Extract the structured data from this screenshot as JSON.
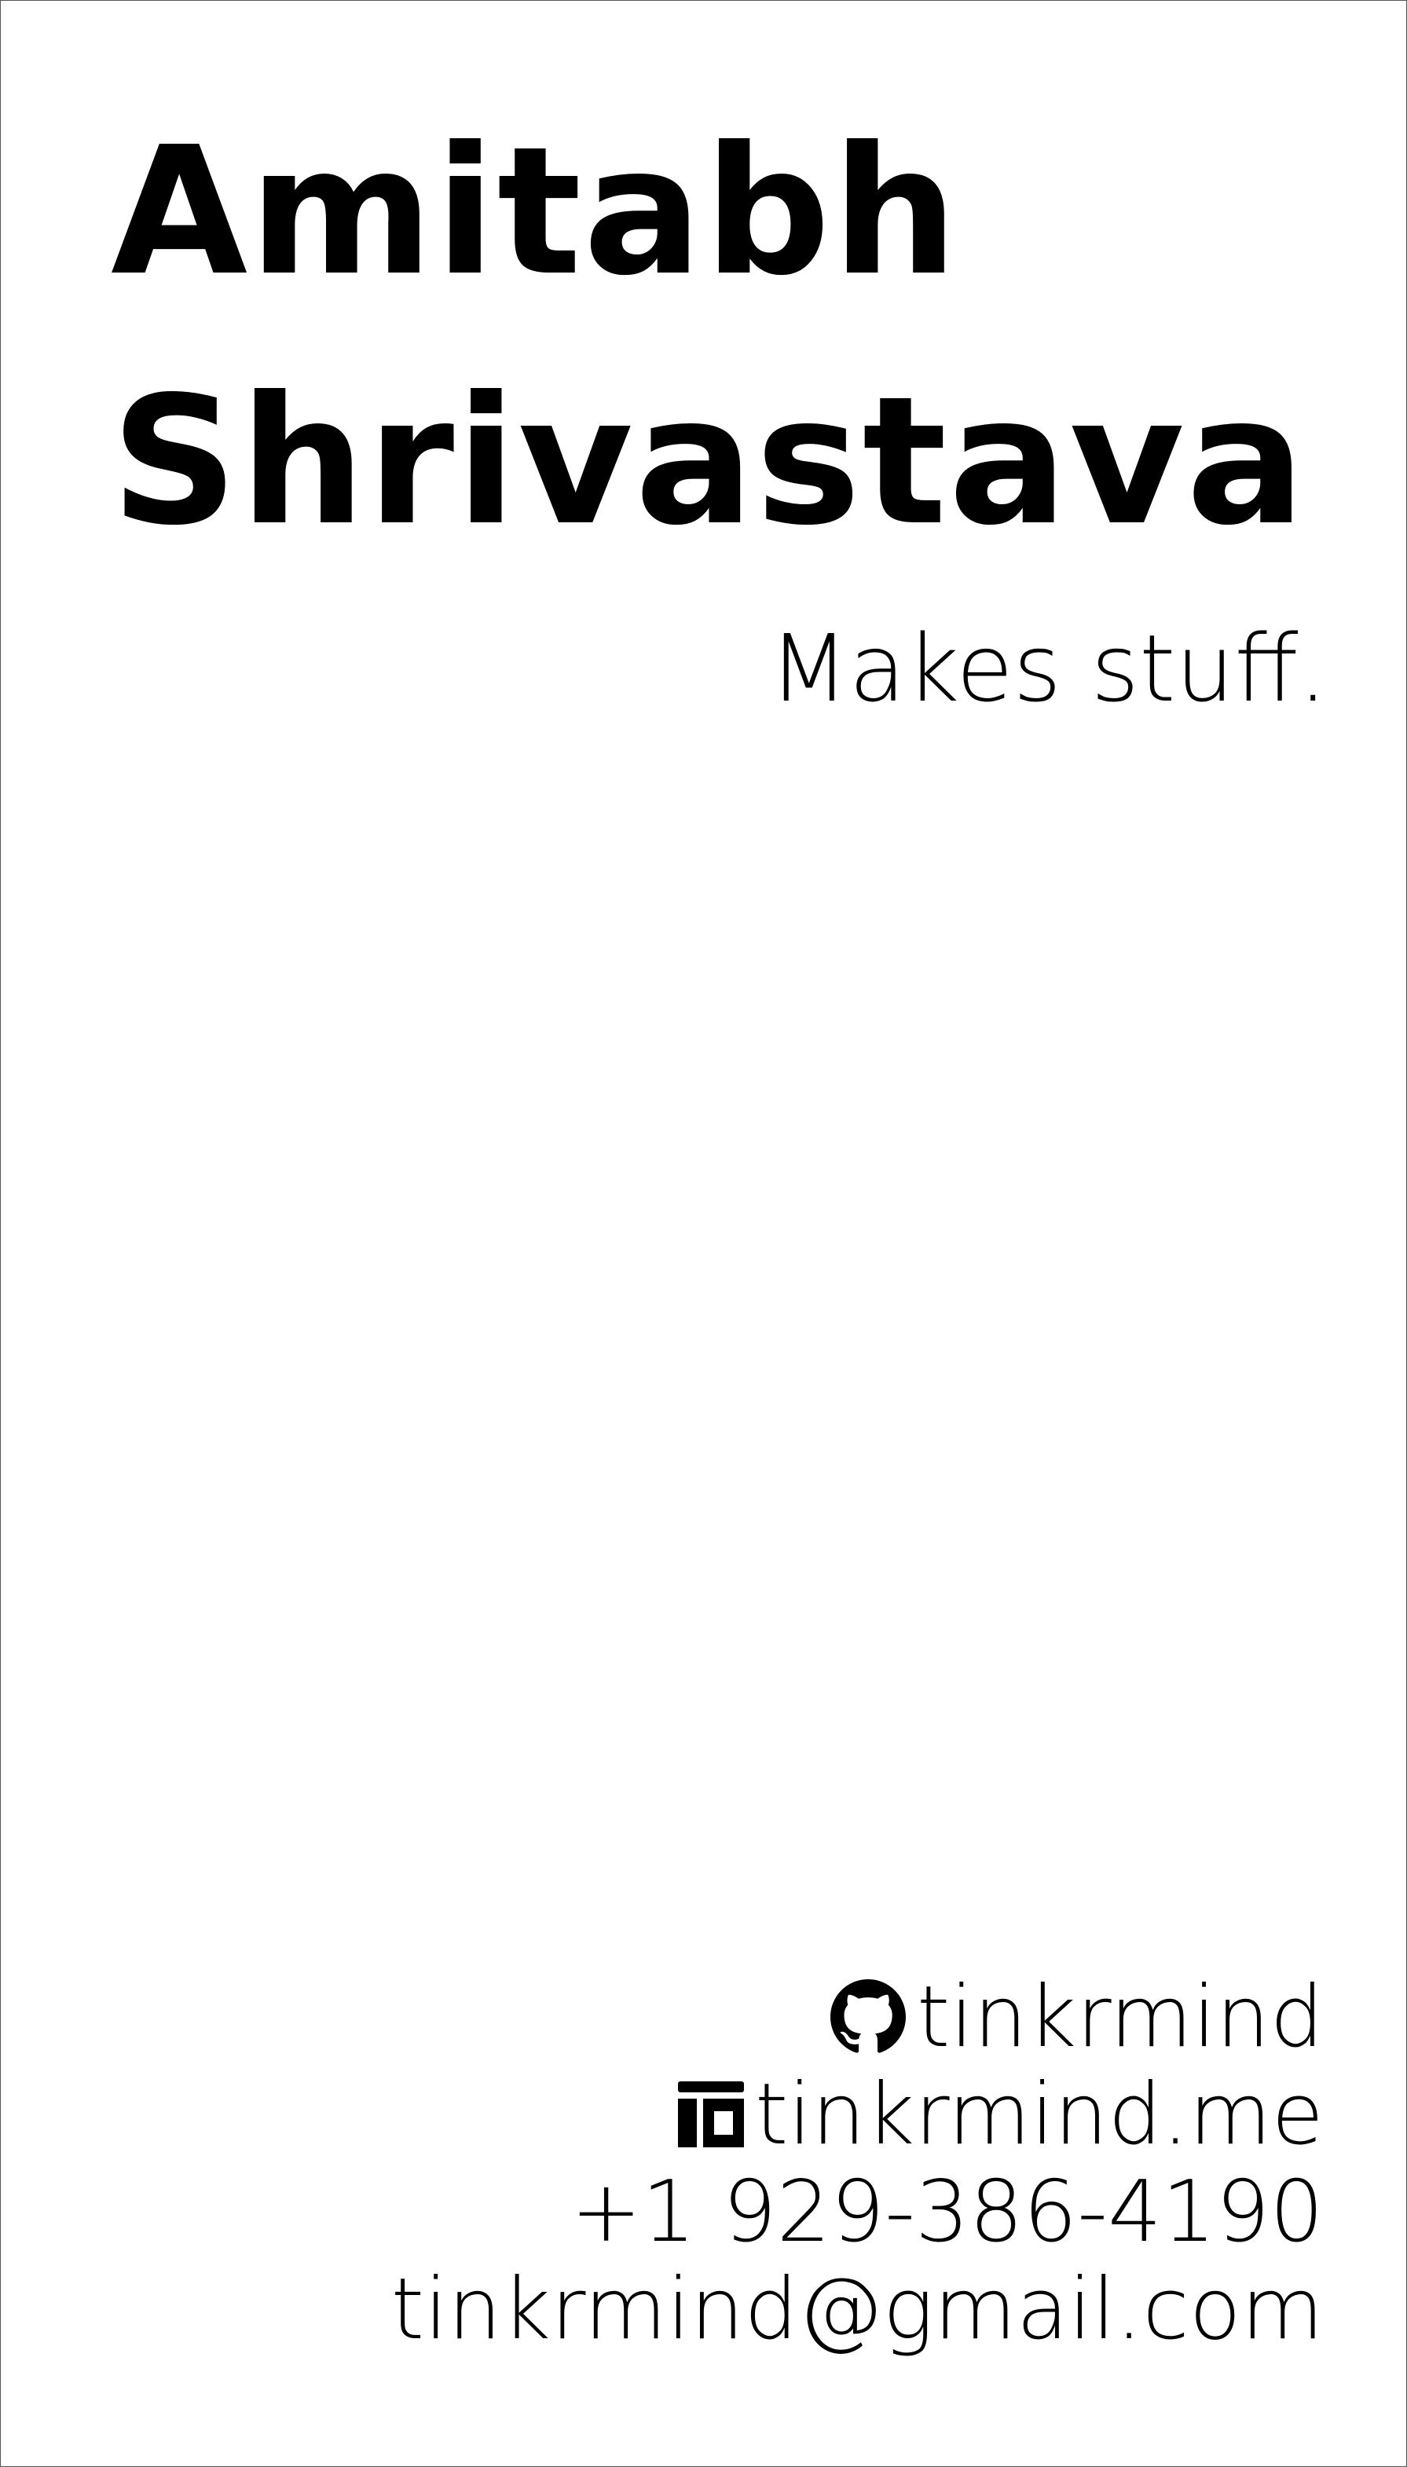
{
  "name": {
    "first": "Amitabh",
    "last": "Shrivastava"
  },
  "tagline": "Makes stuff.",
  "contacts": {
    "github": {
      "icon": "github-icon",
      "label": "tinkrmind"
    },
    "website": {
      "icon": "website-icon",
      "label": "tinkrmind.me"
    },
    "phone": {
      "label": "+1 929-386-4190"
    },
    "email": {
      "label": "tinkrmind@gmail.com"
    }
  },
  "colors": {
    "text": "#000000",
    "background": "#ffffff",
    "border": "#555555"
  }
}
